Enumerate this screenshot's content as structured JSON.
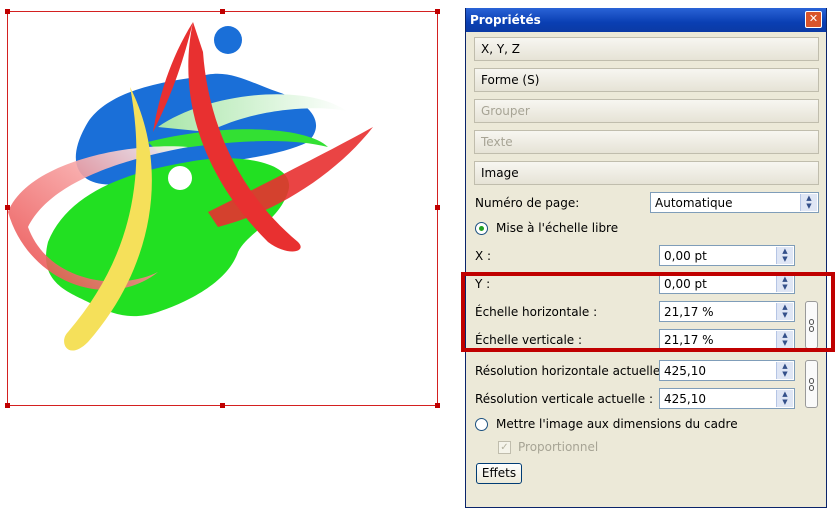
{
  "panel": {
    "title": "Propriétés",
    "close_glyph": "✕",
    "sections": [
      {
        "label": "X, Y, Z",
        "enabled": true
      },
      {
        "label": "Forme (S)",
        "enabled": true
      },
      {
        "label": "Grouper",
        "enabled": false
      },
      {
        "label": "Texte",
        "enabled": false
      },
      {
        "label": "Image",
        "enabled": true
      }
    ],
    "page_number": {
      "label": "Numéro de page:",
      "value": "Automatique"
    },
    "free_scale": {
      "label": "Mise à l'échelle libre",
      "selected": true
    },
    "x": {
      "label": "X :",
      "value": "0,00 pt"
    },
    "y": {
      "label": "Y :",
      "value": "0,00 pt"
    },
    "scale_h": {
      "label": "Échelle horizontale :",
      "value": "21,17 %"
    },
    "scale_v": {
      "label": "Échelle verticale :",
      "value": "21,17 %"
    },
    "res_h": {
      "label": "Résolution horizontale actuelle :",
      "value": "425,10"
    },
    "res_v": {
      "label": "Résolution verticale actuelle :",
      "value": "425,10"
    },
    "fit_frame": {
      "label": "Mettre l'image aux dimensions du cadre",
      "selected": false
    },
    "proportional": {
      "label": "Proportionnel",
      "checked": true,
      "enabled": false
    },
    "effects_button": "Effets"
  },
  "colors": {
    "accent_highlight": "#c00000",
    "title_bar": "#0a3fb3"
  },
  "icons": {
    "close": "close-icon",
    "spin": "spin-arrows-icon",
    "chain": "chain-link-icon"
  }
}
